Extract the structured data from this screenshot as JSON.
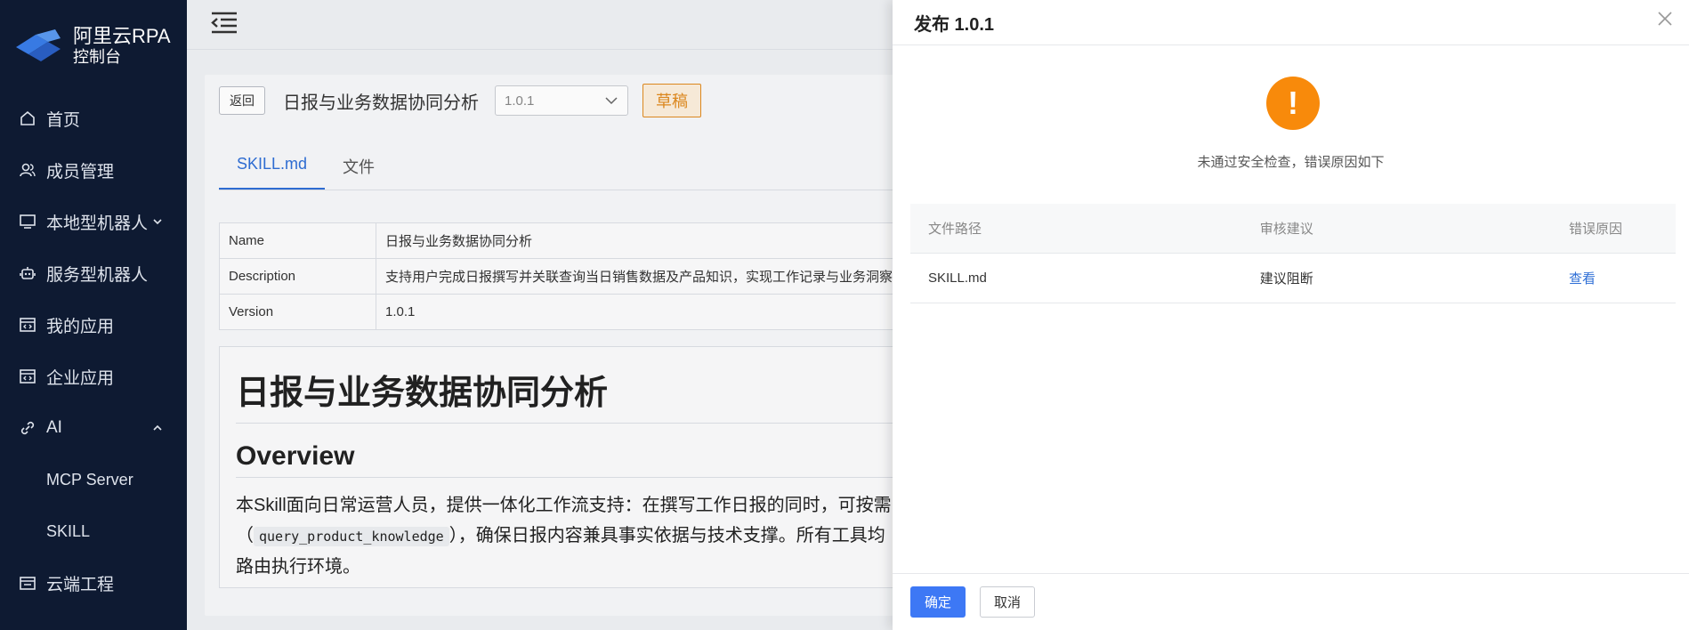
{
  "brand": {
    "title": "阿里云RPA",
    "subtitle": "控制台",
    "accent": "#2f6fd6"
  },
  "sidebar": {
    "items": [
      {
        "label": "首页",
        "icon": "home-icon"
      },
      {
        "label": "成员管理",
        "icon": "users-icon"
      },
      {
        "label": "本地型机器人",
        "icon": "monitor-icon",
        "caret": "down"
      },
      {
        "label": "服务型机器人",
        "icon": "robot-icon"
      },
      {
        "label": "我的应用",
        "icon": "code-app-icon"
      },
      {
        "label": "企业应用",
        "icon": "code-app-icon"
      },
      {
        "label": "AI",
        "icon": "link-icon",
        "caret": "up"
      },
      {
        "label": "云端工程",
        "icon": "cloud-project-icon"
      }
    ],
    "sub_items": [
      {
        "label": "MCP Server"
      },
      {
        "label": "SKILL"
      }
    ]
  },
  "page": {
    "back_label": "返回",
    "skill_title": "日报与业务数据协同分析",
    "version_value": "1.0.1",
    "status_badge": "草稿",
    "tabs": [
      {
        "label": "SKILL.md",
        "active": true
      },
      {
        "label": "文件",
        "active": false
      }
    ],
    "meta": [
      {
        "key": "Name",
        "value": "日报与业务数据协同分析"
      },
      {
        "key": "Description",
        "value": "支持用户完成日报撰写并关联查询当日销售数据及产品知识，实现工作记录与业务洞察"
      },
      {
        "key": "Version",
        "value": "1.0.1"
      }
    ],
    "doc": {
      "h1": "日报与业务数据协同分析",
      "h2": "Overview",
      "p1": "本Skill面向日常运营人员，提供一体化工作流支持：在撰写工作日报的同时，可按需",
      "p2_pre": "（",
      "p2_code": "query_product_knowledge",
      "p2_post": "），确保日报内容兼具事实依据与技术支撑。所有工具均",
      "p3": "路由执行环境。"
    }
  },
  "drawer": {
    "title": "发布 1.0.1",
    "warning_message": "未通过安全检查，错误原因如下",
    "columns": [
      "文件路径",
      "审核建议",
      "错误原因"
    ],
    "rows": [
      {
        "path": "SKILL.md",
        "suggestion": "建议阻断",
        "reason_link": "查看"
      }
    ],
    "confirm_label": "确定",
    "cancel_label": "取消",
    "warning_color": "#f88a0b"
  }
}
